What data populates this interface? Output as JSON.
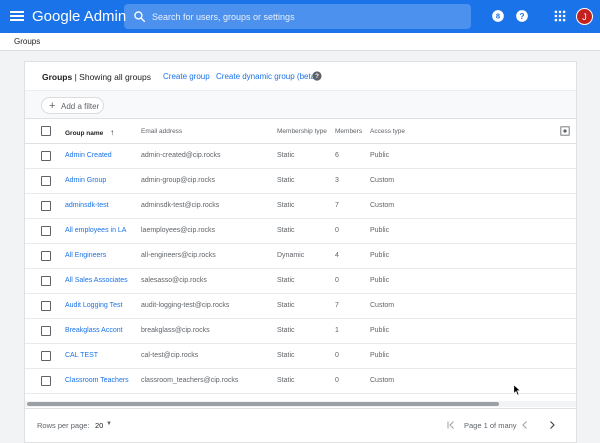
{
  "header": {
    "brand": "Google Admin",
    "search_placeholder": "Search for users, groups or settings",
    "avatar_initial": "J",
    "accent": "#1a73e8"
  },
  "breadcrumb": {
    "label": "Groups"
  },
  "card": {
    "title": "Groups",
    "subtitle": "| Showing all groups",
    "create_group": "Create group",
    "create_dynamic": "Create dynamic group (beta)",
    "add_filter": "Add a filter"
  },
  "table": {
    "headers": {
      "name": "Group name",
      "email": "Email address",
      "type": "Membership type",
      "members": "Members",
      "access": "Access type"
    },
    "rows": [
      {
        "name": "Admin Created",
        "email": "admin-created@cip.rocks",
        "type": "Static",
        "members": "6",
        "access": "Public"
      },
      {
        "name": "Admin Group",
        "email": "admin-group@cip.rocks",
        "type": "Static",
        "members": "3",
        "access": "Custom"
      },
      {
        "name": "adminsdk-test",
        "email": "adminsdk-test@cip.rocks",
        "type": "Static",
        "members": "7",
        "access": "Custom"
      },
      {
        "name": "All employees in LA",
        "email": "laemployees@cip.rocks",
        "type": "Static",
        "members": "0",
        "access": "Public"
      },
      {
        "name": "All Engineers",
        "email": "all-engineers@cip.rocks",
        "type": "Dynamic",
        "members": "4",
        "access": "Public"
      },
      {
        "name": "All Sales Associates",
        "email": "salesasso@cip.rocks",
        "type": "Static",
        "members": "0",
        "access": "Public"
      },
      {
        "name": "Audit Logging Test",
        "email": "audit-logging-test@cip.rocks",
        "type": "Static",
        "members": "7",
        "access": "Custom"
      },
      {
        "name": "Breakglass Accont",
        "email": "breakglass@cip.rocks",
        "type": "Static",
        "members": "1",
        "access": "Public"
      },
      {
        "name": "CAL TEST",
        "email": "cal-test@cip.rocks",
        "type": "Static",
        "members": "0",
        "access": "Public"
      },
      {
        "name": "Classroom Teachers",
        "email": "classroom_teachers@cip.rocks",
        "type": "Static",
        "members": "0",
        "access": "Custom"
      }
    ]
  },
  "footer": {
    "rows_per_page_label": "Rows per page:",
    "rows_per_page_value": "20",
    "page_info": "Page 1 of many"
  }
}
